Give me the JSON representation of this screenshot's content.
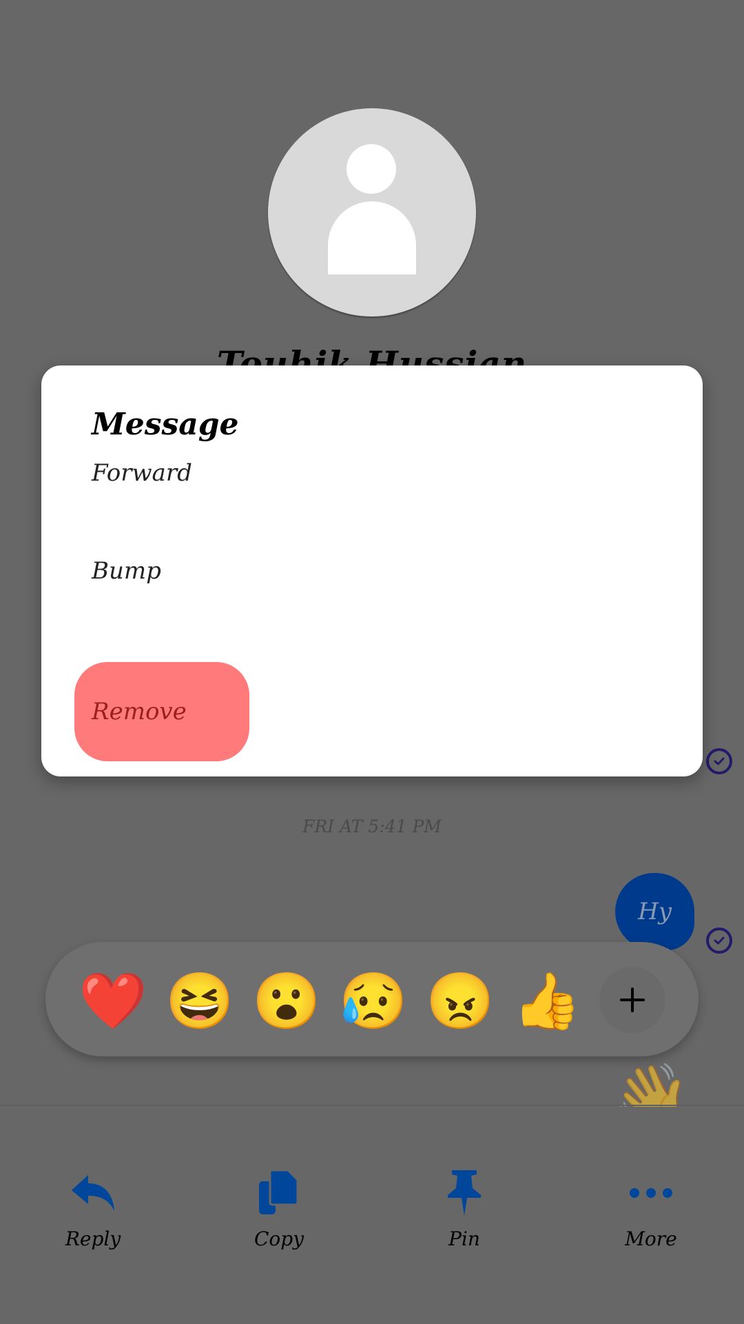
{
  "contact": {
    "name": "Touhik Hussian",
    "avatar_icon": "default-person-avatar"
  },
  "dialog": {
    "title": "Message",
    "items": [
      {
        "label": "Forward"
      },
      {
        "label": "Bump"
      },
      {
        "label": "Remove",
        "destructive": true,
        "highlight_color": "#ff7b7b"
      }
    ]
  },
  "conversation": {
    "timestamp": "FRI AT 5:41 PM",
    "messages": [
      {
        "text": "Hy",
        "sent": true,
        "status": "delivered"
      }
    ]
  },
  "reactions": {
    "emojis": [
      {
        "name": "heart",
        "glyph": "❤️"
      },
      {
        "name": "laughing",
        "glyph": "😆"
      },
      {
        "name": "surprised",
        "glyph": "😮"
      },
      {
        "name": "crying",
        "glyph": "😥"
      },
      {
        "name": "angry",
        "glyph": "😠"
      },
      {
        "name": "thumbs-up",
        "glyph": "👍"
      }
    ],
    "more_label": "+"
  },
  "actions": [
    {
      "label": "Reply",
      "icon": "reply-icon"
    },
    {
      "label": "Copy",
      "icon": "copy-icon"
    },
    {
      "label": "Pin",
      "icon": "pin-icon"
    },
    {
      "label": "More",
      "icon": "more-icon"
    }
  ],
  "colors": {
    "accent": "#00479b",
    "overlay": "#676767",
    "bubble": "#003a8c"
  }
}
